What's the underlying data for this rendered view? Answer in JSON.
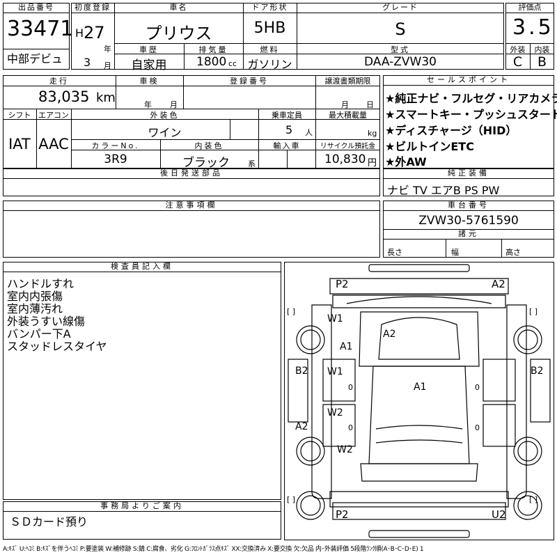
{
  "header": {
    "lot_label": "出品番号",
    "lot_value": "33471",
    "debut_label": "中部デビュ",
    "first_reg_label": "初度登録",
    "era": "H",
    "year": "27",
    "year_unit": "年",
    "month": "3",
    "month_unit": "月",
    "car_name_label": "車名",
    "car_name": "プリウス",
    "door_label": "ドア形状",
    "door": "5HB",
    "grade_label": "グレード",
    "grade": "S",
    "score_label": "評価点",
    "score": "3.5",
    "history_label": "車歴",
    "history": "自家用",
    "displacement_label": "排気量",
    "displacement": "1800",
    "displacement_unit": "cc",
    "fuel_label": "燃料",
    "fuel": "ガソリン",
    "model_label": "型式",
    "model": "DAA-ZVW30",
    "exterior_label": "外装",
    "exterior": "C",
    "interior_label": "内装",
    "interior": "B"
  },
  "mid": {
    "mileage_label": "走行",
    "mileage": "83,035",
    "mileage_unit": "km",
    "inspection_label": "車検",
    "insp_year_unit": "年",
    "insp_month_unit": "月",
    "reg_no_label": "登録番号",
    "transfer_label": "譲渡書類期限",
    "transfer_month_unit": "月",
    "transfer_day_unit": "日",
    "shift_label": "シフト",
    "shift": "IAT",
    "ac_label": "エアコン",
    "ac": "AAC",
    "color_label": "外装色",
    "color": "ワイン",
    "capacity_label": "乗車定員",
    "capacity": "5",
    "capacity_unit": "人",
    "load_label": "最大積載量",
    "load_unit": "kg",
    "color_no_label": "カラーNo.",
    "color_no": "3R9",
    "int_color_label": "内装色",
    "int_color": "ブラック",
    "int_color_unit": "系",
    "import_label": "輸入車",
    "recycle_label": "リサイクル預託金",
    "recycle": "10,830",
    "recycle_unit": "円",
    "later_parts_label": "後日発送部品"
  },
  "sales": {
    "label": "セールスポイント",
    "points": [
      "★純正ナビ・フルセグ・リアカメラ",
      "★スマートキー・プッシュスタート",
      "★ディスチャージ（HID）",
      "★ビルトインETC",
      "★外AW"
    ]
  },
  "equipment": {
    "label": "純正装備",
    "value": "ナビ TV エアB PS PW"
  },
  "notes": {
    "label": "注意事項欄"
  },
  "chassis": {
    "label": "車台番号",
    "value": "ZVW30-5761590",
    "dims_label": "諸元",
    "length_label": "長さ",
    "width_label": "幅",
    "height_label": "高さ"
  },
  "inspector": {
    "label": "検査員記入欄",
    "lines": [
      "ハンドルすれ",
      "室内内張傷",
      "室内薄汚れ",
      "外装うすい線傷",
      "バンパー下A",
      "スタッドレスタイヤ"
    ]
  },
  "office": {
    "label": "事務局よりご案内",
    "text": "ＳＤカード預り"
  },
  "diagram": {
    "bracket": "[   ]",
    "marks": {
      "p2_front": "P2",
      "a2_front": "A2",
      "w1_left": "W1",
      "a1_left": "A1",
      "a2_hood": "A2",
      "b2_left": "B2",
      "b2_right": "B2",
      "w1_door": "W1",
      "a1_center": "A1",
      "w2_door": "W2",
      "a2_left_low": "A2",
      "w2_left": "W2",
      "p2_rear": "P2",
      "u2_rear": "U2",
      "zero1": "0",
      "zero2": "0",
      "zero3": "0",
      "zero4": "0"
    }
  },
  "footer": "A:ｷｽﾞ U:ﾍｺﾐ B:ｷｽﾞを伴うﾍｺﾐ P:要塗装 W:補修跡 S:錆 C:腐食、劣化 G:ﾌﾛﾝﾄｶﾞﾗｽ点ｷｽﾞ XX:交換済み X:要交換 欠:欠品 内･外装評価 5段階ﾗﾝｸ順(A･B･C･D･E) 1"
}
